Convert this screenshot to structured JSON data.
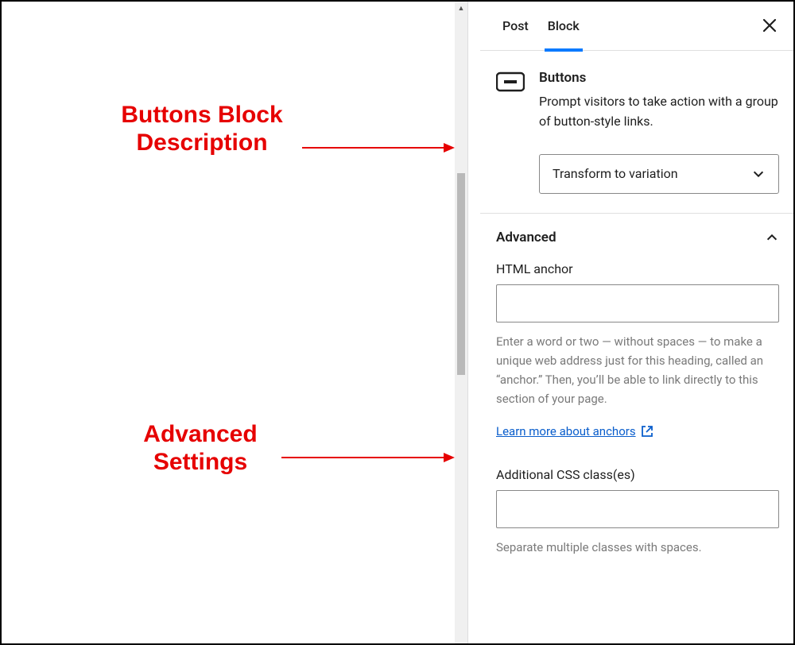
{
  "tabs": {
    "post": "Post",
    "block": "Block"
  },
  "block": {
    "title": "Buttons",
    "description": "Prompt visitors to take action with a group of button-style links.",
    "transform_label": "Transform to variation"
  },
  "advanced": {
    "heading": "Advanced",
    "anchor_label": "HTML anchor",
    "anchor_value": "",
    "anchor_help": "Enter a word or two — without spaces — to make a unique web address just for this heading, called an “anchor.” Then, you’ll be able to link directly to this section of your page.",
    "anchor_link": "Learn more about anchors",
    "css_label": "Additional CSS class(es)",
    "css_value": "",
    "css_help": "Separate multiple classes with spaces."
  },
  "annotations": {
    "desc_line1": "Buttons Block",
    "desc_line2": "Description",
    "adv_line1": "Advanced",
    "adv_line2": "Settings"
  }
}
